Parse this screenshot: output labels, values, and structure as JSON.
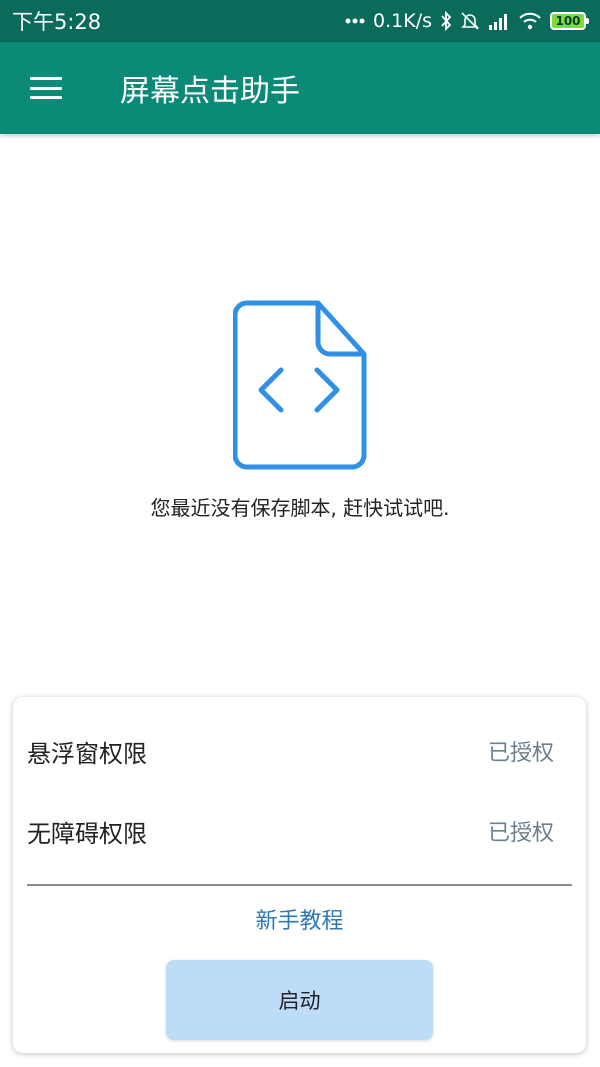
{
  "status_bar": {
    "time": "下午5:28",
    "network_speed": "0.1K/s",
    "battery_level": "100",
    "icons": [
      "dots-icon",
      "bluetooth-icon",
      "mute-icon",
      "signal-icon",
      "wifi-icon",
      "battery-icon"
    ]
  },
  "app_bar": {
    "title": "屏幕点击助手",
    "menu_icon": "hamburger-menu-icon"
  },
  "empty_state": {
    "icon": "code-file-icon",
    "message": "您最近没有保存脚本, 赶快试试吧."
  },
  "permissions": [
    {
      "label": "悬浮窗权限",
      "status": "已授权"
    },
    {
      "label": "无障碍权限",
      "status": "已授权"
    }
  ],
  "tutorial_link": "新手教程",
  "start_button": "启动",
  "colors": {
    "status_bar": "#0b6b5b",
    "app_bar": "#0b8a78",
    "accent_blue": "#2f90e6",
    "link": "#2f78b5",
    "button_bg": "#bcdcf8"
  }
}
